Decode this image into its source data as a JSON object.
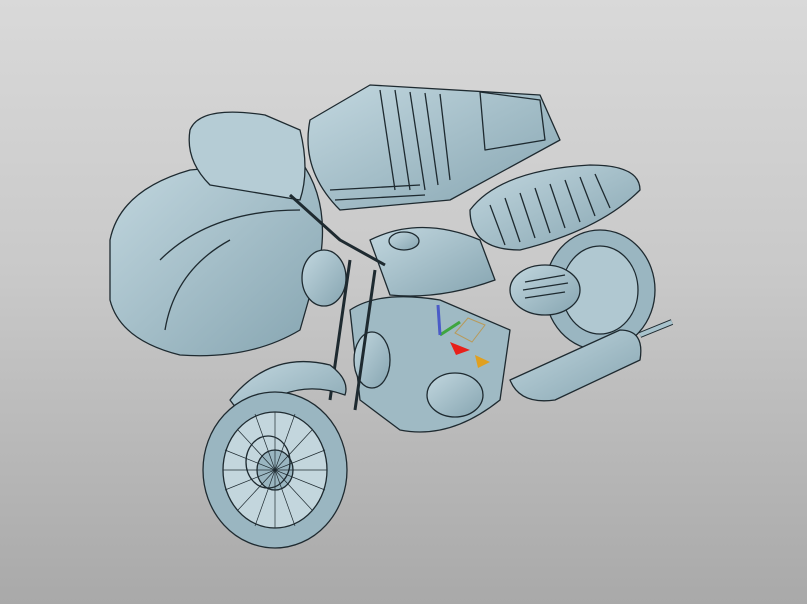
{
  "viewport": {
    "background_top": "#d9d9d9",
    "background_bottom": "#a9a9a9",
    "model_color": "#a8c3cd",
    "model_shade": "#86a5b1",
    "edge_color": "#1e2a30"
  },
  "model": {
    "icon": "motorcycle-with-sidecar-3d-model"
  },
  "triad": {
    "icon": "manipulator-triad-icon",
    "x_color": "#e8201a",
    "y_color": "#3fa63f",
    "z_color": "#4a5bc8",
    "handle_color": "#e0a020"
  }
}
